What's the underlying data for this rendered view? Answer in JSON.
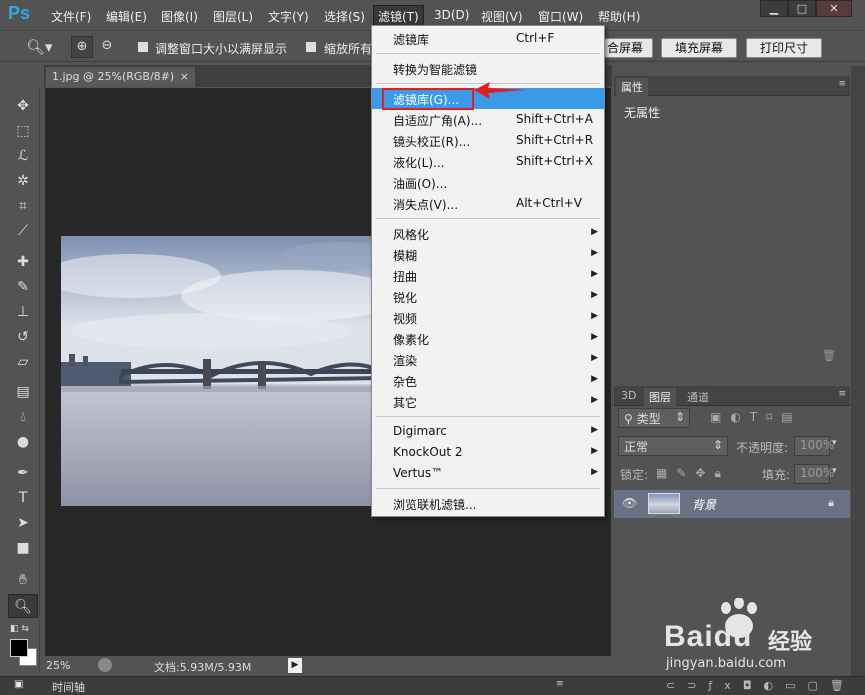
{
  "app": {
    "logo": "Ps"
  },
  "menubar": [
    {
      "label": "文件(F)"
    },
    {
      "label": "编辑(E)"
    },
    {
      "label": "图像(I)"
    },
    {
      "label": "图层(L)"
    },
    {
      "label": "文字(Y)"
    },
    {
      "label": "选择(S)"
    },
    {
      "label": "滤镜(T)",
      "active": true
    },
    {
      "label": "3D(D)"
    },
    {
      "label": "视图(V)"
    },
    {
      "label": "窗口(W)"
    },
    {
      "label": "帮助(H)"
    }
  ],
  "options_bar": {
    "resize_window": "调整窗口大小以满屏显示",
    "zoom_all": "缩放所有",
    "fit_screen": "合屏幕",
    "fill_screen": "填充屏幕",
    "print_size": "打印尺寸"
  },
  "document": {
    "tab_title": "1.jpg @ 25%(RGB/8#)"
  },
  "status_bar": {
    "zoom": "25%",
    "doc_info": "文档:5.93M/5.93M"
  },
  "timeline": {
    "label": "时间轴"
  },
  "filter_menu": {
    "items": [
      {
        "label": "滤镜库",
        "shortcut": "Ctrl+F"
      },
      {
        "separator": true
      },
      {
        "label": "转换为智能滤镜"
      },
      {
        "separator": true
      },
      {
        "label": "滤镜库(G)...",
        "highlighted": true
      },
      {
        "label": "自适应广角(A)...",
        "shortcut": "Shift+Ctrl+A"
      },
      {
        "label": "镜头校正(R)...",
        "shortcut": "Shift+Ctrl+R"
      },
      {
        "label": "液化(L)...",
        "shortcut": "Shift+Ctrl+X"
      },
      {
        "label": "油画(O)..."
      },
      {
        "label": "消失点(V)...",
        "shortcut": "Alt+Ctrl+V"
      },
      {
        "separator": true
      },
      {
        "label": "风格化",
        "submenu": true
      },
      {
        "label": "模糊",
        "submenu": true
      },
      {
        "label": "扭曲",
        "submenu": true
      },
      {
        "label": "锐化",
        "submenu": true
      },
      {
        "label": "视频",
        "submenu": true
      },
      {
        "label": "像素化",
        "submenu": true
      },
      {
        "label": "渲染",
        "submenu": true
      },
      {
        "label": "杂色",
        "submenu": true
      },
      {
        "label": "其它",
        "submenu": true
      },
      {
        "separator": true
      },
      {
        "label": "Digimarc",
        "submenu": true
      },
      {
        "label": "KnockOut 2",
        "submenu": true
      },
      {
        "label": "Vertus™",
        "submenu": true
      },
      {
        "separator": true
      },
      {
        "label": "浏览联机滤镜..."
      }
    ]
  },
  "properties_panel": {
    "tab": "属性",
    "content": "无属性"
  },
  "layers_panel": {
    "tabs": [
      "3D",
      "图层",
      "通道"
    ],
    "filter_kind": "类型",
    "blend_mode": "正常",
    "opacity_label": "不透明度:",
    "opacity_value": "100%",
    "lock_label": "锁定:",
    "fill_label": "填充:",
    "fill_value": "100%",
    "layer_name": "背景"
  },
  "watermark": {
    "brand": "Baidu",
    "brand_cn": "经验",
    "url": "jingyan.baidu.com"
  },
  "colors": {
    "accent": "#3a9ae8",
    "annotation": "#e51d1d",
    "logo": "#32a7e8"
  }
}
